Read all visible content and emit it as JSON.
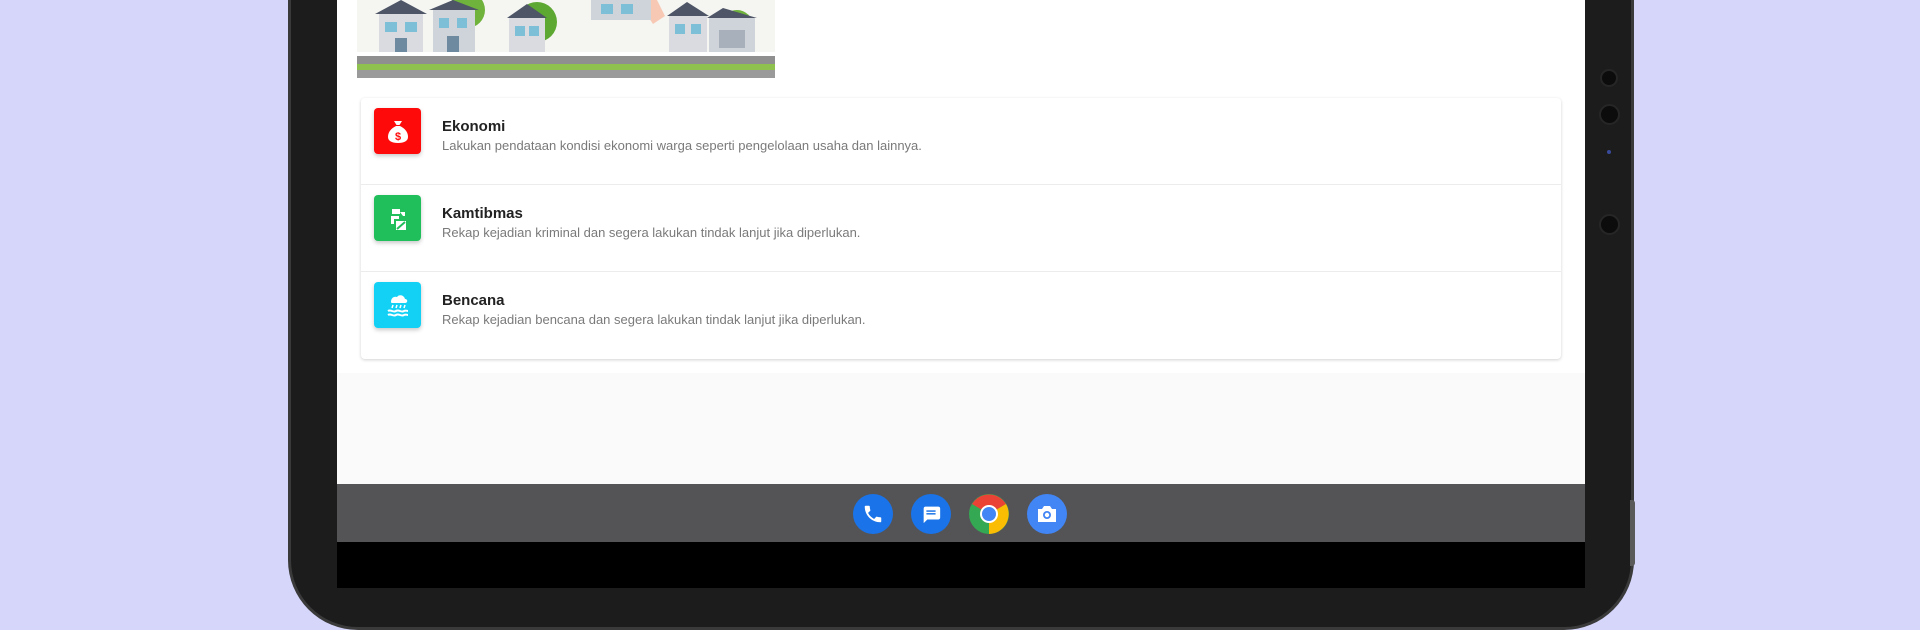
{
  "list": {
    "items": [
      {
        "title": "Ekonomi",
        "desc": "Lakukan pendataan kondisi ekonomi warga seperti pengelolaan usaha dan lainnya.",
        "color": "#ff0a0a",
        "icon": "money-bag-icon"
      },
      {
        "title": "Kamtibmas",
        "desc": "Rekap kejadian kriminal dan segera lakukan tindak lanjut jika diperlukan.",
        "color": "#21bf5b",
        "icon": "police-icon"
      },
      {
        "title": "Bencana",
        "desc": "Rekap kejadian bencana dan segera lakukan tindak lanjut jika diperlukan.",
        "color": "#13d1f5",
        "icon": "flood-icon"
      }
    ]
  },
  "dock": {
    "apps": [
      {
        "name": "phone",
        "icon": "phone-icon",
        "color": "#1a73e8"
      },
      {
        "name": "messages",
        "icon": "messages-icon",
        "color": "#1a73e8"
      },
      {
        "name": "chrome",
        "icon": "chrome-icon",
        "color": "#34a853"
      },
      {
        "name": "camera",
        "icon": "camera-icon",
        "color": "#4285f4"
      }
    ]
  }
}
